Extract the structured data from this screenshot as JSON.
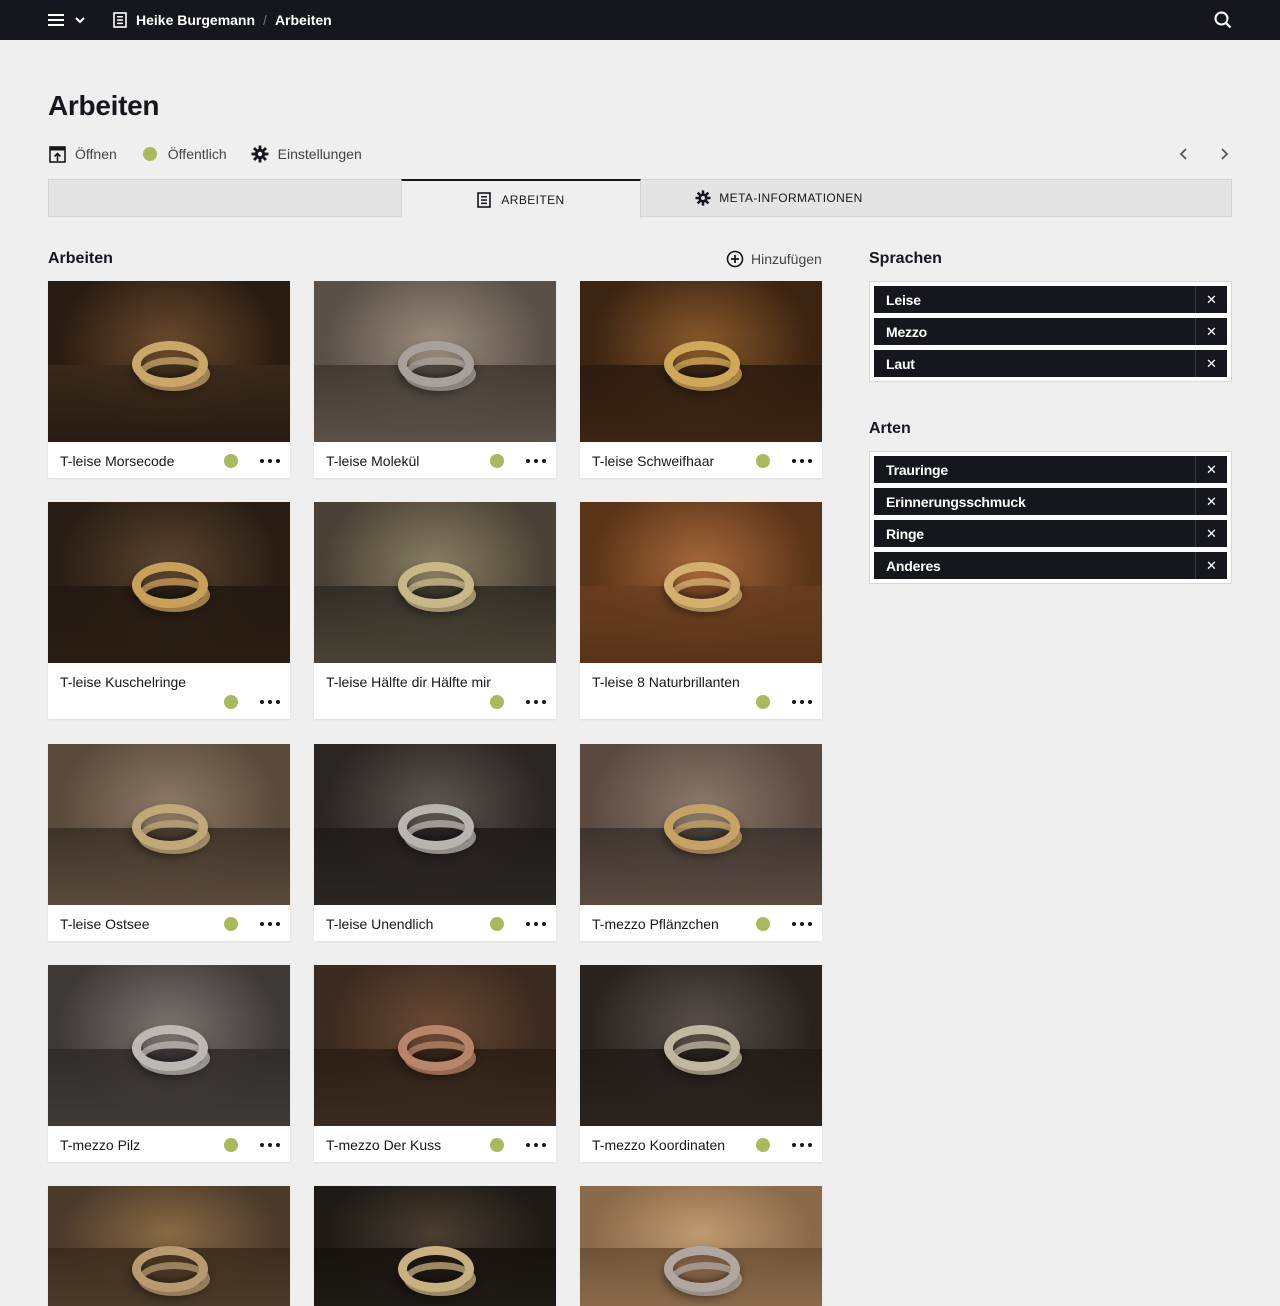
{
  "topbar": {
    "crumb_parent": "Heike Burgemann",
    "crumb_separator": "/",
    "crumb_current": "Arbeiten"
  },
  "page": {
    "title": "Arbeiten",
    "actions": {
      "open": "Öffnen",
      "public": "Öffentlich",
      "settings": "Einstellungen"
    }
  },
  "tabs": {
    "works": "ARBEITEN",
    "meta": "META-INFORMATIONEN"
  },
  "works_section": {
    "title": "Arbeiten",
    "add_label": "Hinzufügen",
    "items": [
      {
        "title": "T-leise Morsecode",
        "status": "public"
      },
      {
        "title": "T-leise Molekül",
        "status": "public"
      },
      {
        "title": "T-leise Schweifhaar",
        "status": "public"
      },
      {
        "title": "T-leise Kuschelringe",
        "status": "public"
      },
      {
        "title": "T-leise Hälfte dir Hälfte mir",
        "status": "public"
      },
      {
        "title": "T-leise 8 Naturbrillanten",
        "status": "public"
      },
      {
        "title": "T-leise Ostsee",
        "status": "public"
      },
      {
        "title": "T-leise Unendlich",
        "status": "public"
      },
      {
        "title": "T-mezzo Pflänzchen",
        "status": "public"
      },
      {
        "title": "T-mezzo Pilz",
        "status": "public"
      },
      {
        "title": "T-mezzo Der Kuss",
        "status": "public"
      },
      {
        "title": "T-mezzo Koordinaten",
        "status": "public"
      },
      {
        "title": "",
        "status": "public"
      },
      {
        "title": "",
        "status": "public"
      },
      {
        "title": "",
        "status": "public"
      }
    ]
  },
  "languages": {
    "title": "Sprachen",
    "tags": [
      "Leise",
      "Mezzo",
      "Laut"
    ]
  },
  "types": {
    "title": "Arten",
    "tags": [
      "Trauringe",
      "Erinnerungsschmuck",
      "Ringe",
      "Anderes"
    ]
  },
  "colors": {
    "topbar": "#16171e",
    "background": "#efefef",
    "status_public": "#a7ba5c"
  }
}
